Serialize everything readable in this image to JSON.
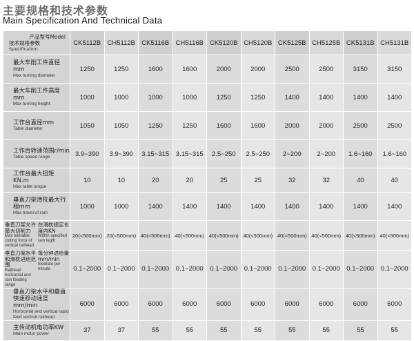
{
  "title_cn": "主要规格和技术参数",
  "title_en": "Main Specification And Technical Data",
  "header": {
    "top_cn": "产品型号",
    "top_en": "Model",
    "bottom_cn": "技术规格参数",
    "bottom_en": "Specification"
  },
  "models": [
    "CK5112B",
    "CH5112B",
    "CK5116B",
    "CH5116B",
    "CK5120B",
    "CH5120B",
    "CK5125B",
    "CH5125B",
    "CK5131B",
    "CH5131B"
  ],
  "rows": [
    {
      "cn": "最大车削工件直径mm",
      "en": "Max turning diameter",
      "values": [
        "1250",
        "1250",
        "1600",
        "1600",
        "2000",
        "2000",
        "2500",
        "2500",
        "3150",
        "3150"
      ]
    },
    {
      "cn": "最大车削工件高度mm",
      "en": "Max turning height",
      "values": [
        "1000",
        "1000",
        "1000",
        "1000",
        "1250",
        "1250",
        "1400",
        "1400",
        "1400",
        "1400"
      ]
    },
    {
      "cn": "工作台直径mm",
      "en": "Table diameter",
      "values": [
        "1050",
        "1050",
        "1250",
        "1250",
        "1600",
        "1600",
        "2000",
        "2000",
        "2500",
        "2500"
      ]
    },
    {
      "cn": "工作台转速范围r/min",
      "en": "Table speed range",
      "values": [
        "3.9~390",
        "3.9~390",
        "3.15~315",
        "3.15~315",
        "2.5~250",
        "2.5~250",
        "2~200",
        "2~200",
        "1.6~160",
        "1.6~160"
      ]
    },
    {
      "cn": "工作台最大扭矩KN.m",
      "en": "Max table torque",
      "values": [
        "10",
        "10",
        "20",
        "20",
        "25",
        "25",
        "32",
        "32",
        "40",
        "40"
      ]
    },
    {
      "cn": "垂直刀架滑枕最大行程mm",
      "en": "Max travel of ram",
      "values": [
        "1000",
        "1000",
        "1400",
        "1400",
        "1400",
        "1400",
        "1400",
        "1400",
        "1400",
        "1400"
      ]
    },
    {
      "split": true,
      "left_cn": "垂直刀架允许最大切削力",
      "left_en": "Max tolerable cutting force of vertical railhead",
      "right_cn": "在滑枕规定长度内KN",
      "right_en": "Within specified ram legth",
      "values": [
        "20(<500mm)",
        "20(<500mm)",
        "40(<500mm)",
        "40(<500mm)",
        "40(<500mm)",
        "40(<500mm)",
        "40(<500mm)",
        "40(<500mm)",
        "40(<500mm)",
        "40(<500mm)"
      ]
    },
    {
      "split": true,
      "left_cn": "垂直刀架水平和滑枕进给范围",
      "left_en": "Railhead horizontal and ram feeding range",
      "right_cn": "每分钟进给量mm/min",
      "right_en": "feedrate per minute",
      "values": [
        "0.1~2000",
        "0.1~2000",
        "0.1~2000",
        "0.1~2000",
        "0.1~2000",
        "0.1~2000",
        "0.1~2000",
        "0.1~2000",
        "0.1~2000",
        "0.1~2000"
      ]
    },
    {
      "cn": "垂直刀架水平和垂直快速移动速度mm/min",
      "en": "Horizontal and vertical rapid feed vertical railhead",
      "values": [
        "6000",
        "6000",
        "6000",
        "6000",
        "6000",
        "6000",
        "6000",
        "6000",
        "6000",
        "6000"
      ]
    },
    {
      "cn": "主传动机电功率KW",
      "en": "Main motor power",
      "values": [
        "37",
        "37",
        "55",
        "55",
        "55",
        "55",
        "55",
        "55",
        "55",
        "55"
      ]
    }
  ]
}
